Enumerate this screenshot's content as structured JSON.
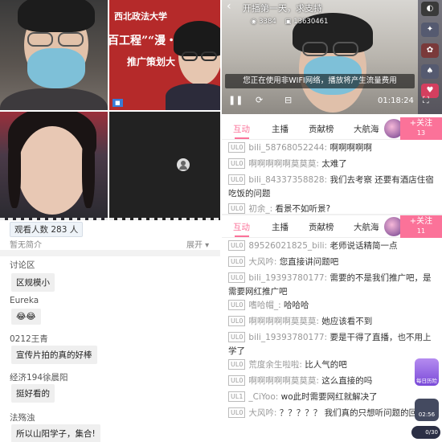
{
  "left": {
    "poster": {
      "line1": "西北政法大学",
      "line2": "百工程”“漫・天",
      "line3": "推广策划大"
    },
    "viewers_label": "观看人数 283 人",
    "intro_label": "暂无简介",
    "expand_label": "展开 ▾",
    "section_title": "讨论区",
    "comments": [
      {
        "user": "",
        "text": "区规模小"
      },
      {
        "user": "Eureka",
        "text": "😂😂"
      },
      {
        "user": "0212王青",
        "text": "宣传片拍的真的好棒"
      },
      {
        "user": "经济194徐晨阳",
        "text": "挺好看的"
      },
      {
        "user": "法殇浊",
        "text": "所以山阳学子，集合!"
      }
    ]
  },
  "right": {
    "video": {
      "back_icon": "‹",
      "title": "开播第一天，求支持",
      "views": "3384",
      "room_id": "13630461",
      "notice": "您正在使用非WIFI网络，播放将产生流量费用",
      "time": "01:18:24"
    },
    "tabs": [
      "互动",
      "主播",
      "贡献榜",
      "大航海"
    ],
    "follow_label": "+关注",
    "follow_count_top": "13",
    "follow_count_bottom": "11",
    "chat_top": [
      {
        "level": "UL0",
        "user": "bili_58768052244:",
        "text": "啊啊啊啊啊"
      },
      {
        "level": "UL0",
        "user": "啊啊啊啊啊莫莫莫:",
        "text": "太难了"
      },
      {
        "level": "UL0",
        "user": "bili_84337358828:",
        "text": "我们去考察 还要有酒店住宿吃饭的问题"
      },
      {
        "level": "UL0",
        "user": "初余_:",
        "text": "看景不如听景?"
      }
    ],
    "chat_bottom": [
      {
        "level": "UL0",
        "user": "89526021825_bili:",
        "text": "老师说话精简一点"
      },
      {
        "level": "UL0",
        "user": "大风吟:",
        "text": "您直接讲问题吧"
      },
      {
        "level": "UL0",
        "user": "bili_19393780177:",
        "text": "需要的不是我们推广吧，是需要网红推广吧"
      },
      {
        "level": "UL0",
        "user": "嗜哈帽_:",
        "text": "哈哈哈"
      },
      {
        "level": "UL0",
        "user": "啊啊啊啊啊莫莫莫:",
        "text": "她应该看不到"
      },
      {
        "level": "UL0",
        "user": "bili_19393780177:",
        "text": "要是干得了直播，也不用上学了"
      },
      {
        "level": "UL0",
        "user": "荒度余生啦啦:",
        "text": "比人气的吧"
      },
      {
        "level": "UL0",
        "user": "啊啊啊啊啊莫莫莫:",
        "text": "这么直接的吗"
      },
      {
        "level": "UL1",
        "user": "_CiYoo:",
        "text": "wo此时需要网红就解决了"
      },
      {
        "level": "UL0",
        "user": "大风吟:",
        "text": "？？？？？ 我们真的只想听问题的回"
      }
    ],
    "gift_label": "每日历险",
    "gift_timer": "02:56",
    "counter": "0/30"
  },
  "colors": {
    "accent": "#fb7299"
  }
}
